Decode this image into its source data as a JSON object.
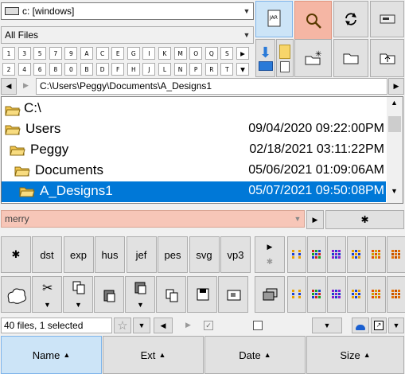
{
  "drive": {
    "value": "c: [windows]"
  },
  "filter": {
    "value": "All Files"
  },
  "letters_row1": [
    "1",
    "3",
    "5",
    "7",
    "9",
    "A",
    "C",
    "E",
    "G",
    "I",
    "K",
    "M",
    "O",
    "Q",
    "S",
    "▶"
  ],
  "letters_row2": [
    "2",
    "4",
    "6",
    "8",
    "0",
    "B",
    "D",
    "F",
    "H",
    "J",
    "L",
    "N",
    "P",
    "R",
    "T",
    "▼"
  ],
  "path": {
    "value": "C:\\Users\\Peggy\\Documents\\A_Designs1"
  },
  "tree": [
    {
      "name": "C:\\",
      "date": ""
    },
    {
      "name": "Users",
      "date": "09/04/2020 09:22:00PM"
    },
    {
      "name": "Peggy",
      "date": "02/18/2021 03:11:22PM"
    },
    {
      "name": "Documents",
      "date": "05/06/2021 01:09:06AM"
    },
    {
      "name": "A_Designs1",
      "date": "05/07/2021 09:50:08PM"
    }
  ],
  "search": {
    "value": "merry"
  },
  "asterisk": "✱",
  "tags": [
    "dst",
    "exp",
    "hus",
    "jef",
    "pes",
    "svg",
    "vp3"
  ],
  "status": {
    "text": "40 files, 1 selected"
  },
  "columns": [
    {
      "label": "Name",
      "sort": "▲"
    },
    {
      "label": "Ext",
      "sort": "▲"
    },
    {
      "label": "Date",
      "sort": "▲"
    },
    {
      "label": "Size",
      "sort": "▲"
    }
  ],
  "colors": {
    "selection": "#0078d7",
    "highlight_blue": "#cce4f7",
    "highlight_pink": "#f5b6a4",
    "folder": "#f3c750"
  }
}
